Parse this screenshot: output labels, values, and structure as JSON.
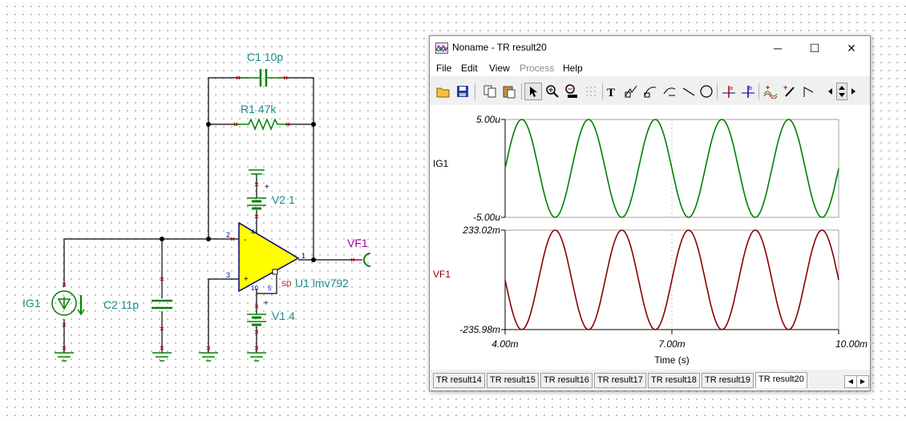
{
  "schematic": {
    "c1": {
      "name": "C1",
      "value": "10p"
    },
    "r1": {
      "name": "R1",
      "value": "47k"
    },
    "v2": {
      "name": "V2",
      "value": "1"
    },
    "v1": {
      "name": "V1",
      "value": "4"
    },
    "u1": {
      "name": "U1",
      "value": "lmv792"
    },
    "c2": {
      "name": "C2",
      "value": "11p"
    },
    "ig1": {
      "name": "IG1"
    },
    "vf1": {
      "name": "VF1"
    },
    "pins": {
      "p1": "1",
      "p2": "2",
      "p3": "3",
      "p4": "4",
      "p5": "5",
      "p10": "10",
      "sd": "SD",
      "plus": "+",
      "minus": "-"
    }
  },
  "window": {
    "title": "Noname - TR result20",
    "buttons": {
      "minimize": "─",
      "maximize": "☐",
      "close": "✕"
    },
    "menu": [
      {
        "label": "File",
        "disabled": false
      },
      {
        "label": "Edit",
        "disabled": false
      },
      {
        "label": "View",
        "disabled": false
      },
      {
        "label": "Process",
        "disabled": true
      },
      {
        "label": "Help",
        "disabled": false
      }
    ],
    "toolbar_icons": [
      "open-icon",
      "save-icon",
      "copy-icon",
      "paste-icon",
      "pointer-icon",
      "zoom-in-icon",
      "zoom-100-icon",
      "grid-icon",
      "text-icon",
      "draw-icon",
      "curve-icon",
      "label-curve-icon",
      "line-icon",
      "circle-icon",
      "cursor-a-icon",
      "cursor-b-icon",
      "add-curve-icon",
      "add-marker-icon",
      "pen-icon",
      "scroll-left-icon",
      "scroll-updown-icon",
      "scroll-right-icon"
    ],
    "tabs": [
      "TR result14",
      "TR result15",
      "TR result16",
      "TR result17",
      "TR result18",
      "TR result19",
      "TR result20"
    ],
    "active_tab": 6
  },
  "chart_data": [
    {
      "type": "line",
      "series": [
        {
          "name": "IG1",
          "color": "#008000",
          "amplitude": 5.0,
          "unit": "u",
          "frequency_per_ms": 0.8333,
          "phase_at_start": 0.0
        }
      ],
      "x": {
        "range": [
          4.0,
          10.0
        ],
        "unit": "ms"
      },
      "y": {
        "range": [
          -5.0,
          5.0
        ],
        "ticks": [
          "5.00u",
          "-5.00u"
        ]
      },
      "y_label": "IG1"
    },
    {
      "type": "line",
      "series": [
        {
          "name": "VF1",
          "color": "#8b0000",
          "max": 233.02,
          "min": -235.98,
          "frequency_per_ms": 0.8333
        }
      ],
      "x": {
        "range": [
          4.0,
          10.0
        ],
        "unit": "ms",
        "ticks": [
          "4.00m",
          "7.00m",
          "10.00m"
        ]
      },
      "y": {
        "range": [
          -235.98,
          233.02
        ],
        "ticks": [
          "233.02m",
          "-235.98m"
        ]
      },
      "y_label": "VF1",
      "xlabel": "Time (s)"
    }
  ]
}
